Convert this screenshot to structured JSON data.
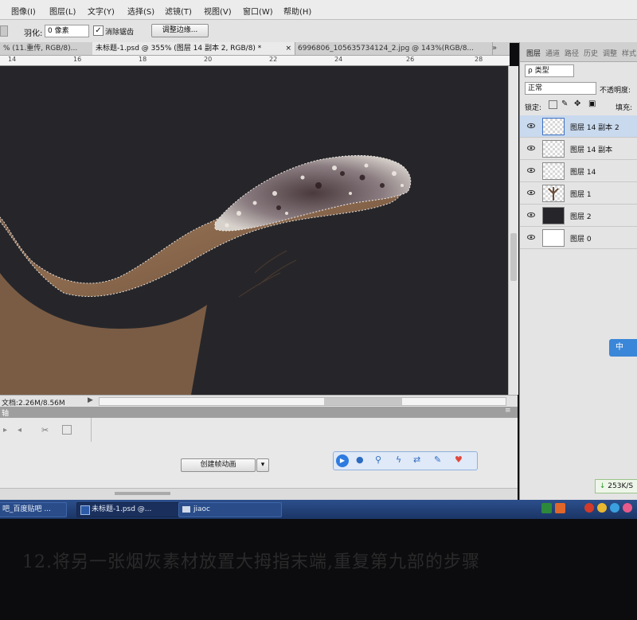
{
  "menu": {
    "items": [
      "图像(I)",
      "图层(L)",
      "文字(Y)",
      "选择(S)",
      "滤镜(T)",
      "视图(V)",
      "窗口(W)",
      "帮助(H)"
    ]
  },
  "options_bar": {
    "feather_label": "羽化:",
    "feather_value": "0 像素",
    "antialias_label": "消除锯齿",
    "antialias_checked": true,
    "refine_edge_button": "调整边缘..."
  },
  "tabs": [
    {
      "label": "% (11.重传, RGB/8)...",
      "close": "×",
      "active": false
    },
    {
      "label": "未标题-1.psd @ 355% (图层 14 副本 2, RGB/8) *",
      "close": "×",
      "active": true
    },
    {
      "label": "6996806_105635734124_2.jpg @ 143%(RGB/8...",
      "close": "×",
      "active": false
    }
  ],
  "ruler": {
    "numbers": [
      "14",
      "16",
      "18",
      "20",
      "22",
      "24",
      "26",
      "28"
    ]
  },
  "status_bar": {
    "doc_size": "文档:2.26M/8.56M"
  },
  "timeline": {
    "header_label": "轴",
    "create_animation_button": "创建帧动画"
  },
  "layers_panel": {
    "tabs": [
      "图层",
      "通道",
      "路径",
      "历史",
      "调整",
      "样式"
    ],
    "filter_label": "ρ 类型",
    "blend_mode": "正常",
    "opacity_label": "不透明度:",
    "lock_label": "锁定:",
    "fill_label": "填充:",
    "layers": [
      {
        "name": "图层 14 副本 2",
        "selected": true,
        "thumb": "checker"
      },
      {
        "name": "图层 14 副本",
        "selected": false,
        "thumb": "checker"
      },
      {
        "name": "图层 14",
        "selected": false,
        "thumb": "checker"
      },
      {
        "name": "图层 1",
        "selected": false,
        "thumb": "hand"
      },
      {
        "name": "图层 2",
        "selected": false,
        "thumb": "dark"
      },
      {
        "name": "图层 0",
        "selected": false,
        "thumb": "white"
      }
    ],
    "ime_label": "中",
    "network_speed": "253K/S"
  },
  "taskbar": {
    "items": [
      {
        "label": "吧_百度贴吧 ...",
        "active": false
      },
      {
        "label": "未标题-1.psd @...",
        "active": true
      },
      {
        "label": "jiaoc",
        "active": false
      }
    ]
  },
  "caption": {
    "text": "12.将另一张烟灰素材放置大拇指末端,重复第九部的步骤"
  },
  "colors": {
    "canvas_bg": "#26262a",
    "skin": "#8c6a4e",
    "selection_blue": "#c9d9ee",
    "taskbar_blue": "#1b3566"
  }
}
